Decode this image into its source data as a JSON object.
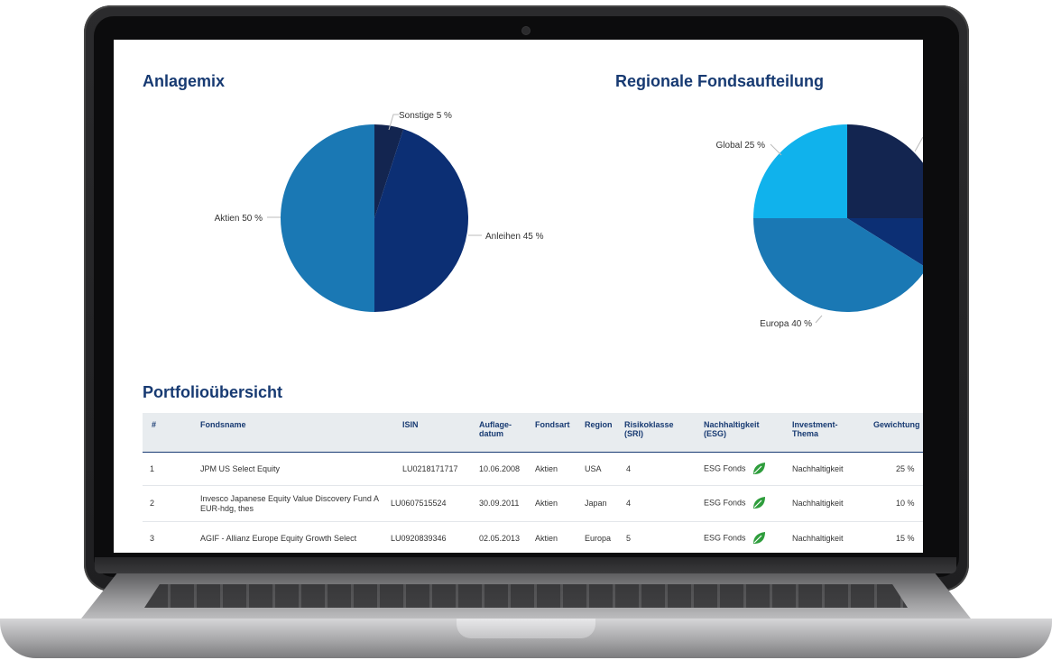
{
  "sections": {
    "asset_mix_title": "Anlagemix",
    "regional_title": "Regionale Fondsaufteilung",
    "portfolio_title": "Portfolioübersicht"
  },
  "chart_data": [
    {
      "type": "pie",
      "title": "Anlagemix",
      "labels": [
        "Sonstige 5 %",
        "Anleihen 45 %",
        "Aktien 50 %"
      ],
      "values": [
        5,
        45,
        50
      ],
      "colors": [
        "#132550",
        "#0c2f74",
        "#1a78b4"
      ]
    },
    {
      "type": "pie",
      "title": "Regionale Fondsaufteilung",
      "labels": [
        "Global 25 %",
        "Europa 40 %"
      ],
      "values": [
        25,
        40
      ],
      "colors": [
        "#10b2ec",
        "#1a78b4"
      ]
    }
  ],
  "table": {
    "headers": [
      "#",
      "Fondsname",
      "ISIN",
      "Auflage-\ndatum",
      "Fondsart",
      "Region",
      "Risikoklasse\n(SRI)",
      "Nachhaltigkeit\n(ESG)",
      "Investment-\nThema",
      "Gewichtung"
    ],
    "rows": [
      [
        "1",
        "JPM US Select Equity",
        "LU0218171717",
        "10.06.2008",
        "Aktien",
        "USA",
        "4",
        "ESG Fonds",
        "Nachhaltigkeit",
        "25 %"
      ],
      [
        "2",
        "Invesco Japanese Equity Value Discovery Fund A EUR-hdg, thes",
        "LU0607515524",
        "30.09.2011",
        "Aktien",
        "Japan",
        "4",
        "ESG Fonds",
        "Nachhaltigkeit",
        "10 %"
      ],
      [
        "3",
        "AGIF - Allianz Europe Equity Growth Select",
        "LU0920839346",
        "02.05.2013",
        "Aktien",
        "Europa",
        "5",
        "ESG Fonds",
        "Nachhaltigkeit",
        "15 %"
      ]
    ]
  },
  "icons": {
    "esg": "leaf-icon"
  },
  "colors": {
    "heading": "#173a72",
    "leaf": "#2e9d3c"
  }
}
